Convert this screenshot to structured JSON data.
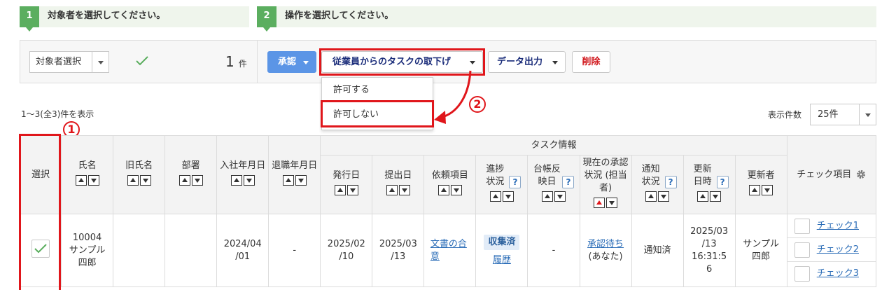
{
  "steps": [
    {
      "number": "1",
      "text": "対象者を選択してください。"
    },
    {
      "number": "2",
      "text": "操作を選択してください。"
    }
  ],
  "toolbar": {
    "target_select": "対象者選択",
    "count_value": "1",
    "count_unit": "件",
    "approve_button": "承認",
    "withdraw_button": "従業員からのタスクの取下げ",
    "export_button": "データ出力",
    "delete_button": "削除"
  },
  "dropdown": {
    "items": [
      "許可する",
      "許可しない"
    ]
  },
  "annotations": {
    "one": "1",
    "two": "2"
  },
  "summary": "1〜3(全3)件を表示",
  "per_page": {
    "label": "表示件数",
    "value": "25件"
  },
  "table": {
    "group_header": "タスク情報",
    "headers": {
      "select": "選択",
      "name": "氏名",
      "old_name": "旧氏名",
      "dept": "部署",
      "join": "入社年月日",
      "leave": "退職年月日",
      "issue": "発行日",
      "submit": "提出日",
      "request": "依頼項目",
      "progress": "進捗状況",
      "ledger": "台帳反映日",
      "approval": "現在の承認状況 (担当者)",
      "notify": "通知状況",
      "updated_at": "更新日時",
      "updater": "更新者",
      "check": "チェック項目"
    },
    "help_mark": "?",
    "row": {
      "name": "10004\nサンプル\n四郎",
      "old_name": "",
      "dept": "",
      "join": "2024/04\n/01",
      "leave": "-",
      "issue": "2025/02\n/10",
      "submit": "2025/03\n/13",
      "request": "文書の合意",
      "progress_badge": "収集済",
      "progress_link": "履歴",
      "ledger": "-",
      "approval_link": "承認待ち",
      "approval_sub": "(あなた)",
      "notify": "通知済",
      "updated_at": "2025/03\n/13\n16:31:5\n6",
      "updater": "サンプル\n四郎",
      "checks": [
        "チェック1",
        "チェック2",
        "チェック3"
      ]
    }
  },
  "colors": {
    "accent_green": "#5bae5f",
    "annotation_red": "#e0161b",
    "link_blue": "#2a6cb7",
    "primary_button": "#5b95e6"
  }
}
